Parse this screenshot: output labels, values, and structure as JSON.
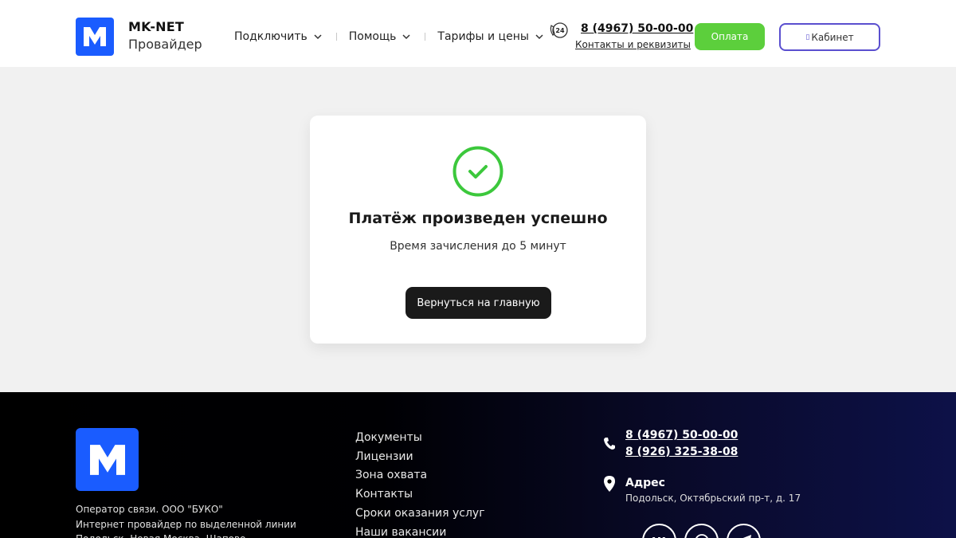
{
  "header": {
    "brand_name": "MK-NET",
    "brand_sub": "Провайдер",
    "nav": [
      {
        "label": "Подключить"
      },
      {
        "label": "Помощь"
      },
      {
        "label": "Тарифы и цены"
      }
    ],
    "phone": "8 (4967) 50-00-00",
    "contacts_link": "Контакты и реквизиты",
    "pay_label": "Оплата",
    "cabinet_label": "Кабинет",
    "support_badge": "24"
  },
  "card": {
    "title": "Платёж произведен успешно",
    "subtitle": "Время зачисления до 5 минут",
    "button_label": "Вернуться на главную"
  },
  "footer": {
    "info_lines": [
      "Оператор связи. ООО \"БУКО\"",
      "Интернет провайдер по выделенной линии",
      "Подольск, Новая Москва, Шапово"
    ],
    "links": [
      "Документы",
      "Лицензии",
      "Зона охвата",
      "Контакты",
      "Сроки оказания услуг",
      "Наши вакансии"
    ],
    "phone1": "8 (4967) 50-00-00",
    "phone2": "8 (926) 325-38-08",
    "address_label": "Адрес",
    "address": "Подольск, Октябрьский пр-т, д. 17",
    "socials": [
      "vk-icon",
      "whatsapp-icon",
      "telegram-icon"
    ]
  },
  "colors": {
    "brand_blue": "#1a5cff",
    "pay_green": "#5ccf3c",
    "success_green": "#3cc83c",
    "cabinet_border": "#5a4fcf",
    "dark_button": "#1a1a1a"
  }
}
